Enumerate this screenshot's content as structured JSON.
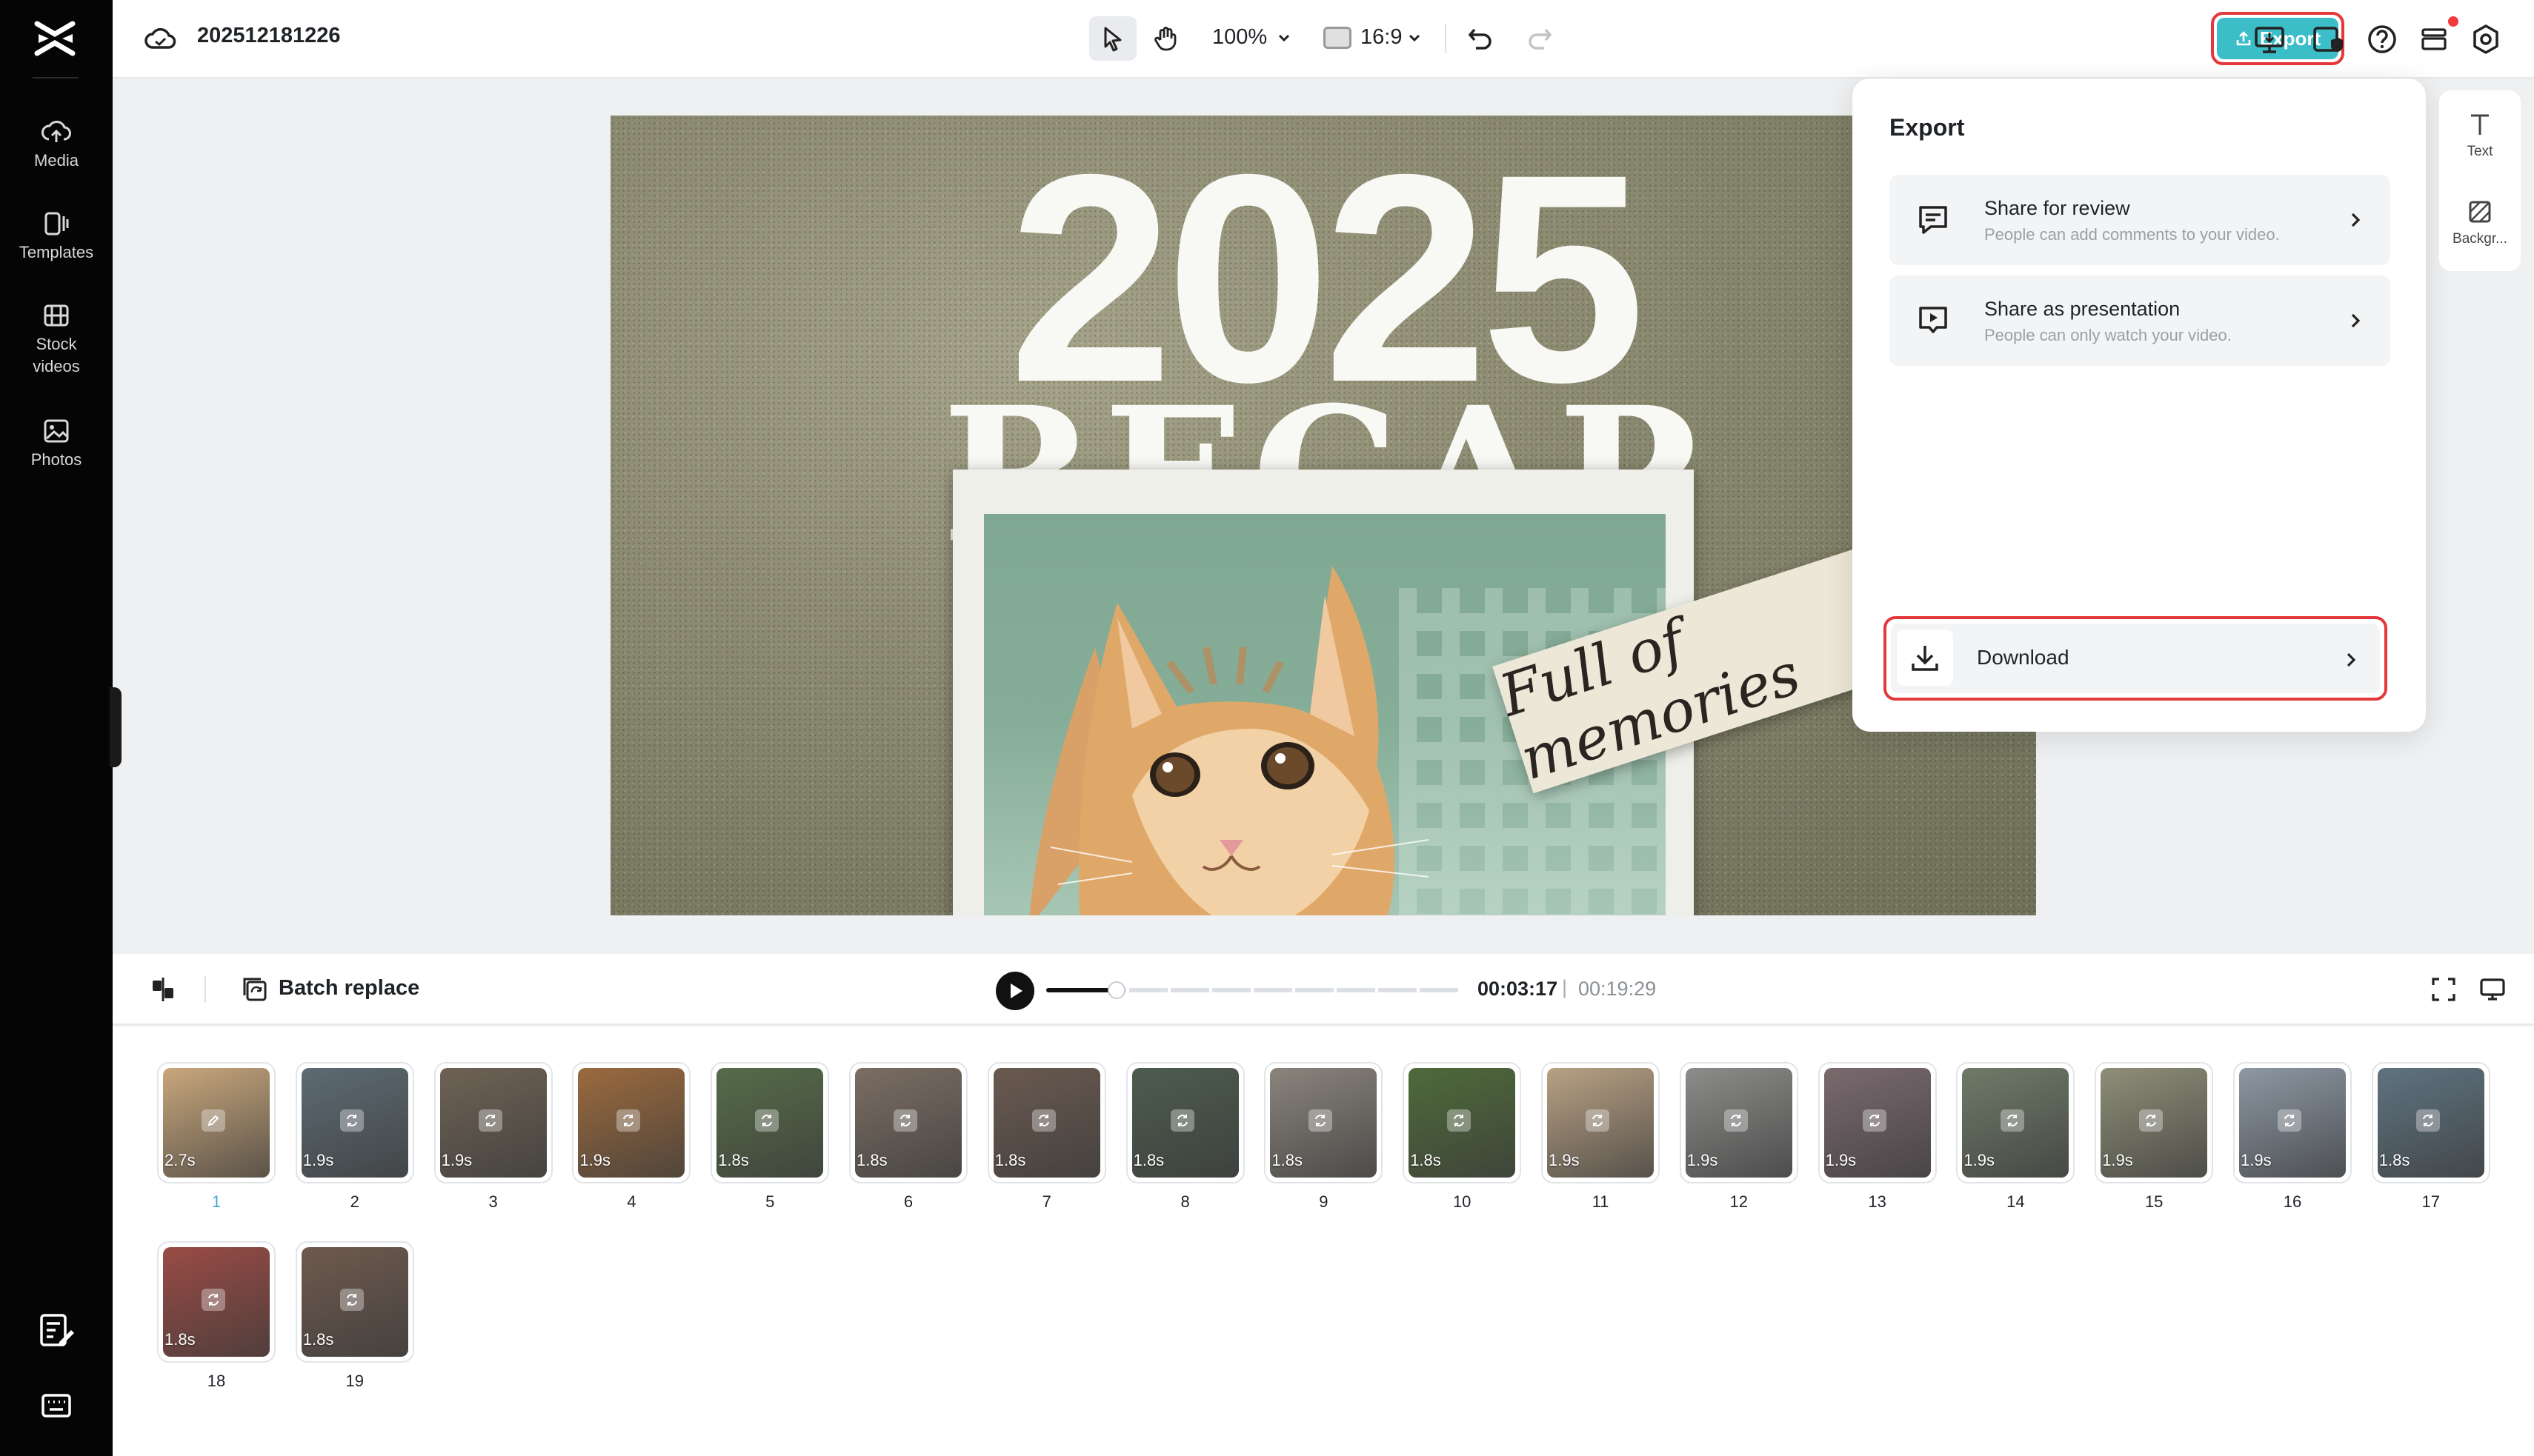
{
  "header": {
    "project_name": "202512181226",
    "zoom": "100%",
    "aspect_ratio": "16:9",
    "export_label": "Export"
  },
  "sidebar": {
    "items": [
      {
        "label": "Media"
      },
      {
        "label": "Templates"
      },
      {
        "label": "Stock videos"
      },
      {
        "label": "Photos"
      }
    ]
  },
  "canvas": {
    "year_text": "2025",
    "recap_text": "RECAP",
    "sticker_text": "Full of memories"
  },
  "export_panel": {
    "title": "Export",
    "options": [
      {
        "title": "Share for review",
        "desc": "People can add comments to your video."
      },
      {
        "title": "Share as presentation",
        "desc": "People can only watch your video."
      }
    ],
    "download_label": "Download"
  },
  "right_panel": {
    "items": [
      {
        "label": "Text"
      },
      {
        "label": "Backgr..."
      }
    ]
  },
  "playback": {
    "batch_replace_label": "Batch replace",
    "current_time": "00:03:17",
    "separator": "|",
    "total_time": "00:19:29",
    "progress_fraction": 0.17
  },
  "thumbnails": [
    {
      "num": "1",
      "dur": "2.7s",
      "color": "#c9a77c"
    },
    {
      "num": "2",
      "dur": "1.9s",
      "color": "#5d6b73"
    },
    {
      "num": "3",
      "dur": "1.9s",
      "color": "#6e6254"
    },
    {
      "num": "4",
      "dur": "1.9s",
      "color": "#9b6a3e"
    },
    {
      "num": "5",
      "dur": "1.8s",
      "color": "#566c48"
    },
    {
      "num": "6",
      "dur": "1.8s",
      "color": "#7b6e63"
    },
    {
      "num": "7",
      "dur": "1.8s",
      "color": "#6a5a50"
    },
    {
      "num": "8",
      "dur": "1.8s",
      "color": "#4d5c4e"
    },
    {
      "num": "9",
      "dur": "1.8s",
      "color": "#8a847c"
    },
    {
      "num": "10",
      "dur": "1.8s",
      "color": "#4f6a3a"
    },
    {
      "num": "11",
      "dur": "1.9s",
      "color": "#b8a184"
    },
    {
      "num": "12",
      "dur": "1.9s",
      "color": "#8c8c8a"
    },
    {
      "num": "13",
      "dur": "1.9s",
      "color": "#7a6a6e"
    },
    {
      "num": "14",
      "dur": "1.9s",
      "color": "#6f7a68"
    },
    {
      "num": "15",
      "dur": "1.9s",
      "color": "#8e8e78"
    },
    {
      "num": "16",
      "dur": "1.9s",
      "color": "#8d98a4"
    },
    {
      "num": "17",
      "dur": "1.8s",
      "color": "#5f7380"
    },
    {
      "num": "18",
      "dur": "1.8s",
      "color": "#9a4b45"
    },
    {
      "num": "19",
      "dur": "1.8s",
      "color": "#6e5a4e"
    }
  ]
}
